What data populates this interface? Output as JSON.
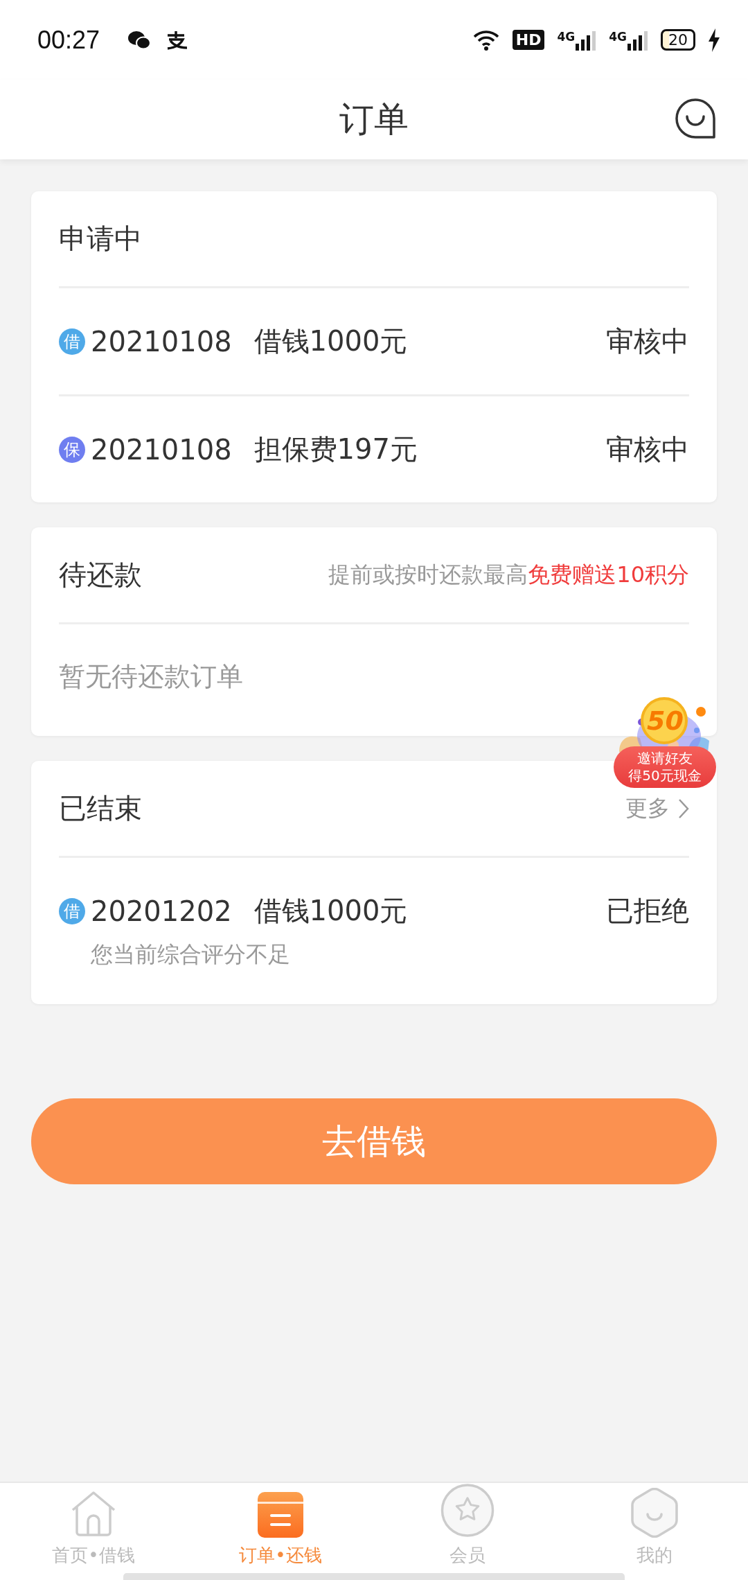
{
  "status_bar": {
    "time": "00:27",
    "hd_label": "HD",
    "networks": [
      "4G",
      "4G"
    ],
    "battery": "20"
  },
  "header": {
    "title": "订单"
  },
  "applying": {
    "title": "申请中",
    "rows": [
      {
        "badge": "借",
        "color": "#4fa9e8",
        "date": "20210108",
        "desc": "借钱1000元",
        "status": "审核中"
      },
      {
        "badge": "保",
        "color": "#6f7ef0",
        "date": "20210108",
        "desc": "担保费197元",
        "status": "审核中"
      }
    ]
  },
  "pending": {
    "title": "待还款",
    "note": "提前或按时还款最高",
    "note_highlight": "免费赠送10积分",
    "empty": "暂无待还款订单"
  },
  "finished": {
    "title": "已结束",
    "more": "更多",
    "rows": [
      {
        "badge": "借",
        "color": "#4fa9e8",
        "date": "20201202",
        "desc": "借钱1000元",
        "status": "已拒绝",
        "reason": "您当前综合评分不足"
      }
    ]
  },
  "promo": {
    "coin": "50",
    "line_1": "邀请好友",
    "line_2": "得50元现金"
  },
  "action_button": "去借钱",
  "tabs": [
    {
      "kind": "home",
      "label": "首页•借钱",
      "selected": false
    },
    {
      "kind": "orders",
      "label": "订单•还钱",
      "selected": true
    },
    {
      "kind": "member",
      "label": "会员",
      "selected": false
    },
    {
      "kind": "mine",
      "label": "我的",
      "selected": false
    }
  ]
}
